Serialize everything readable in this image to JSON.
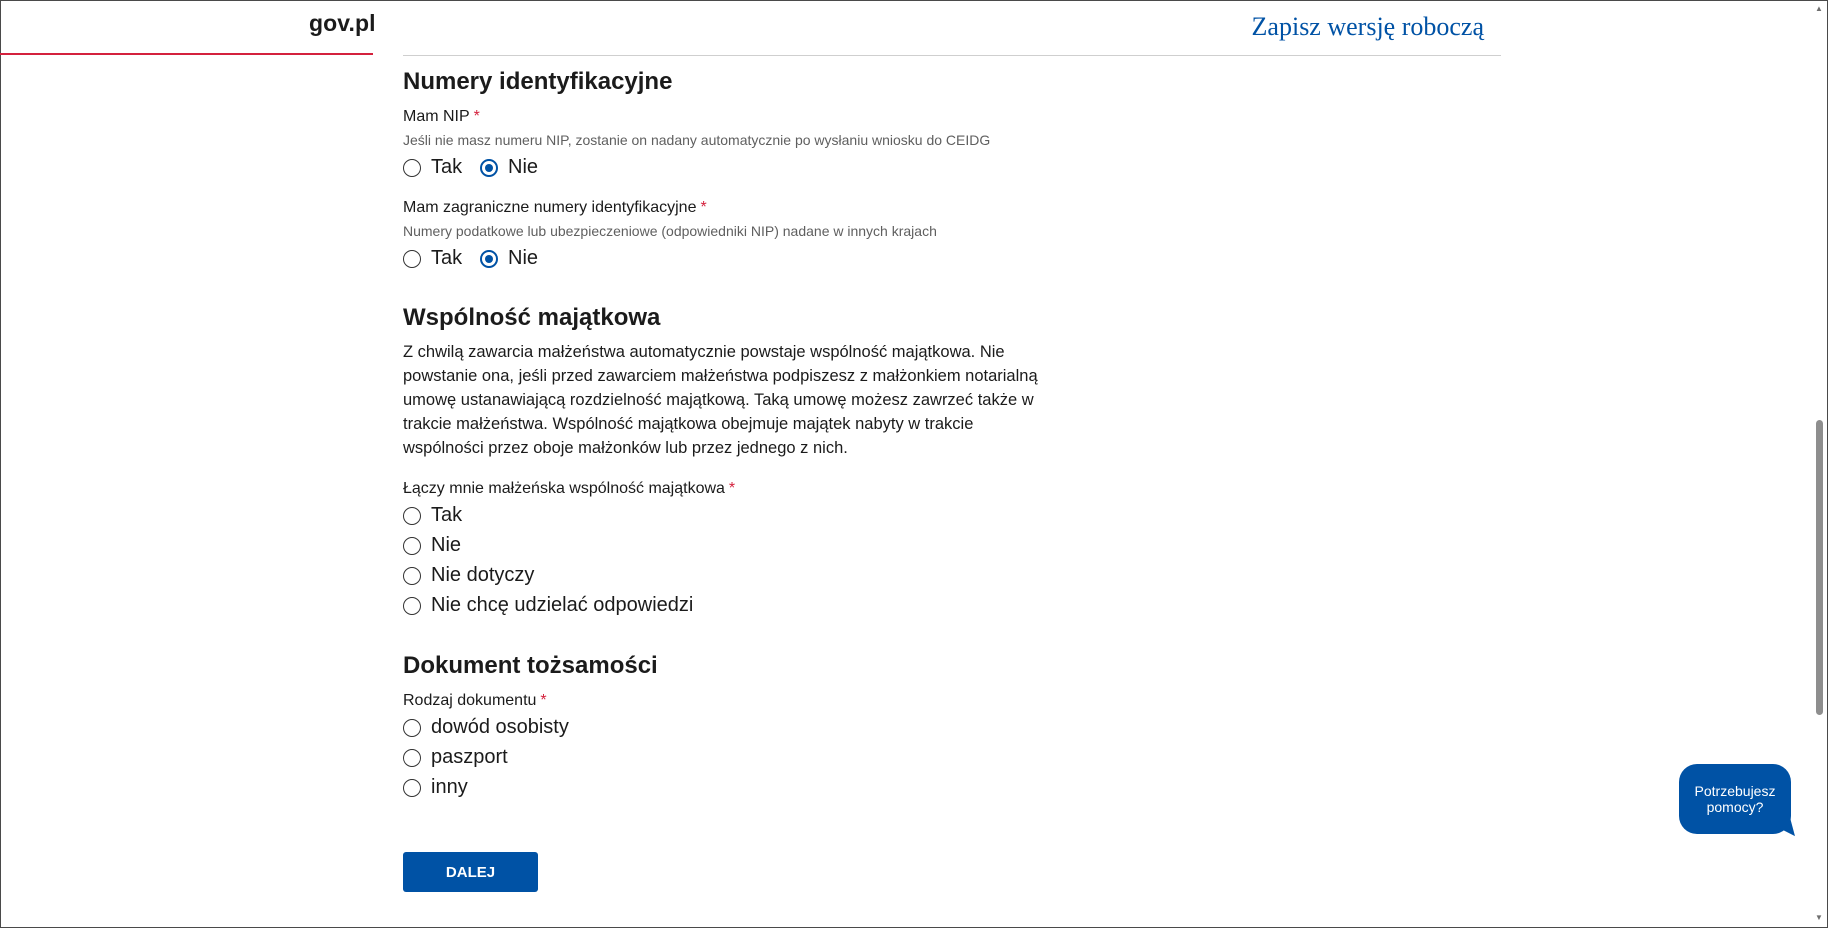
{
  "header": {
    "brand": "gov.pl",
    "save_draft": "Zapisz wersję roboczą"
  },
  "section_ids": {
    "title": "Numery identyfikacyjne",
    "nip": {
      "label": "Mam NIP",
      "required": "*",
      "hint": "Jeśli nie masz numeru NIP, zostanie on nadany automatycznie po wysłaniu wniosku do CEIDG",
      "options": [
        "Tak",
        "Nie"
      ],
      "selected": "Nie"
    },
    "foreign": {
      "label": "Mam zagraniczne numery identyfikacyjne",
      "required": "*",
      "hint": "Numery podatkowe lub ubezpieczeniowe (odpowiedniki NIP) nadane w innych krajach",
      "options": [
        "Tak",
        "Nie"
      ],
      "selected": "Nie"
    }
  },
  "section_property": {
    "title": "Wspólność majątkowa",
    "description": "Z chwilą zawarcia małżeństwa automatycznie powstaje wspólność majątkowa. Nie powstanie ona, jeśli przed zawarciem małżeństwa podpiszesz z małżonkiem notarialną umowę ustanawiającą rozdzielność majątkową. Taką umowę możesz zawrzeć także w trakcie małżeństwa. Wspólność majątkowa obejmuje majątek nabyty w trakcie wspólności przez oboje małżonków lub przez jednego z nich.",
    "question": {
      "label": "Łączy mnie małżeńska wspólność majątkowa",
      "required": "*",
      "options": [
        "Tak",
        "Nie",
        "Nie dotyczy",
        "Nie chcę udzielać odpowiedzi"
      ],
      "selected": null
    }
  },
  "section_document": {
    "title": "Dokument tożsamości",
    "question": {
      "label": "Rodzaj dokumentu",
      "required": "*",
      "options": [
        "dowód osobisty",
        "paszport",
        "inny"
      ],
      "selected": null
    }
  },
  "actions": {
    "next": "DALEJ"
  },
  "help": {
    "label_line1": "Potrzebujesz",
    "label_line2": "pomocy?"
  },
  "colors": {
    "accent": "#0052a5",
    "brand_red": "#d4213d"
  }
}
